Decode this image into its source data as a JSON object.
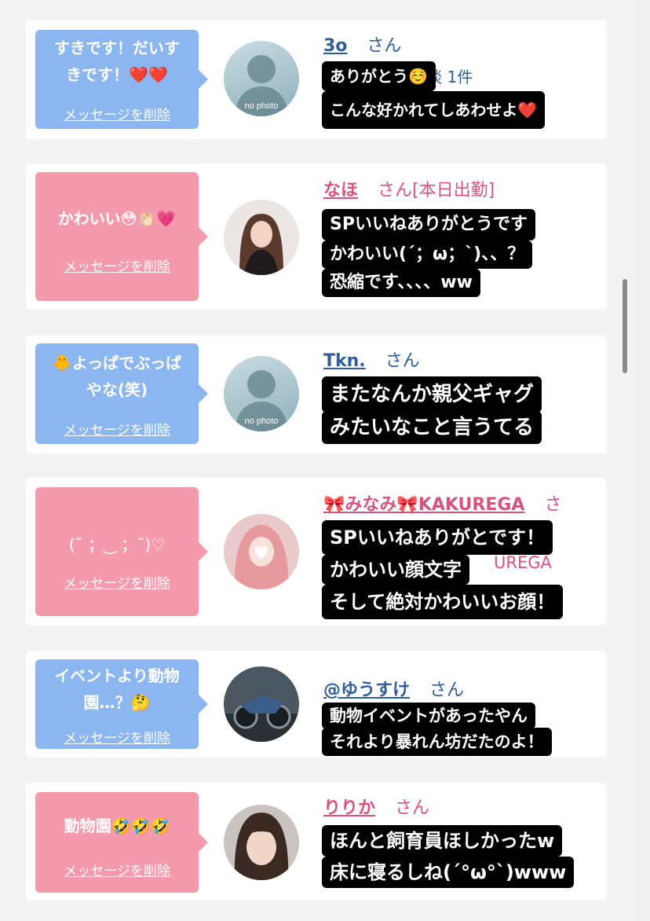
{
  "posts": [
    {
      "message": "すきです！だいす\nきです！❤️❤️",
      "delete_label": "メッセージを削除",
      "avatar": "no photo",
      "name": "3o",
      "suffix": "さん",
      "sub": "ありがとう☺️ 談 1件",
      "stickers": [
        "ありがとう☺️",
        "こんな好かれてしあわせよ❤️"
      ]
    },
    {
      "message": "かわいい😳👏🏻💗",
      "delete_label": "メッセージを削除",
      "avatar": "photo",
      "name": "なほ",
      "suffix": "さん[本日出勤]",
      "stickers": [
        "SPいいねありがとうです",
        "かわいい(´；ω；`)、、？",
        "恐縮です、、、、ww"
      ]
    },
    {
      "message": "🐥よっぱでぶっぱ\nやな(笑)",
      "delete_label": "メッセージを削除",
      "avatar": "no photo",
      "name": "Tkn.",
      "suffix": "さん",
      "stickers": [
        "またなんか親父ギャグ",
        "みたいなこと言うてる"
      ]
    },
    {
      "message": "(˘ ；‿ ；˘)♡",
      "delete_label": "メッセージを削除",
      "avatar": "photo",
      "name": "🎀みなみ🎀KAKUREGA",
      "suffix": "さ",
      "hidden_sub": "UREGA",
      "stickers": [
        "SPいいねありがとです！",
        "かわいい顔文字",
        "そして絶対かわいいお顔！"
      ]
    },
    {
      "message": "イベントより動物\n園…？🤔",
      "delete_label": "メッセージを削除",
      "avatar": "photo",
      "name": "@ゆうすけ",
      "suffix": "さん",
      "stickers": [
        "動物イベントがあったやん",
        "それより暴れん坊だたのよ！"
      ]
    },
    {
      "message": "動物園🤣🤣🤣",
      "delete_label": "メッセージを削除",
      "avatar": "photo",
      "name": "りりか",
      "suffix": "さん",
      "stickers": [
        "ほんと飼育員ほしかったw",
        "床に寝るしね(´°ω°`)www"
      ]
    }
  ],
  "colors": {
    "blue_bubble": "#8bb6f0",
    "pink_bubble": "#f59aad",
    "blue_name": "#2e5e9e",
    "pink_name": "#d9547d"
  }
}
